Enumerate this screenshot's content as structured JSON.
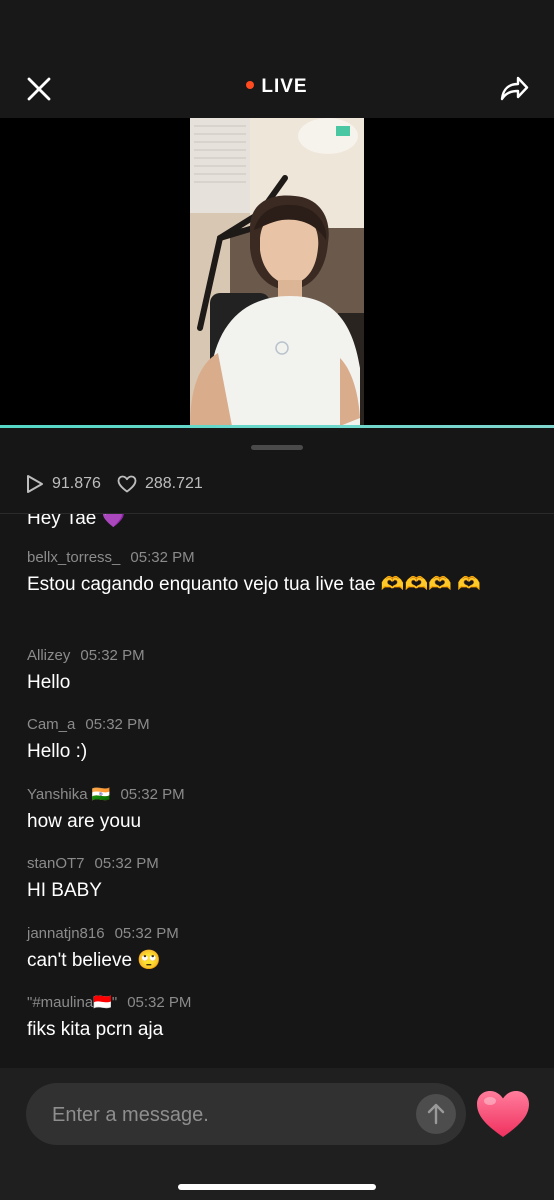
{
  "header": {
    "live_label": "LIVE",
    "close_icon": "close-icon",
    "share_icon": "share-icon"
  },
  "colors": {
    "live_dot": "#ff4b1f",
    "progress": "#55d8c6",
    "heart": "#ff4f7a"
  },
  "stats": {
    "plays": "91.876",
    "likes": "288.721"
  },
  "chat": {
    "partial_message": "Hey Tae 💜",
    "messages": [
      {
        "user": "bellx_torress_",
        "time": "05:32 PM",
        "text": "Estou cagando enquanto vejo tua live tae 🫶🫶🫶 🫶"
      },
      {
        "user": "Allizey",
        "time": "05:32 PM",
        "text": "Hello"
      },
      {
        "user": "Cam_a",
        "time": "05:32 PM",
        "text": "Hello :)"
      },
      {
        "user": "Yanshika 🇮🇳",
        "time": "05:32 PM",
        "text": "how are youu"
      },
      {
        "user": "stanOT7",
        "time": "05:32 PM",
        "text": "HI BABY"
      },
      {
        "user": "jannatjn816",
        "time": "05:32 PM",
        "text": "can't believe 🙄"
      },
      {
        "user": "\"#maulina🇮🇩\"",
        "time": "05:32 PM",
        "text": "fiks kita pcrn aja"
      }
    ]
  },
  "input": {
    "placeholder": "Enter a message."
  }
}
